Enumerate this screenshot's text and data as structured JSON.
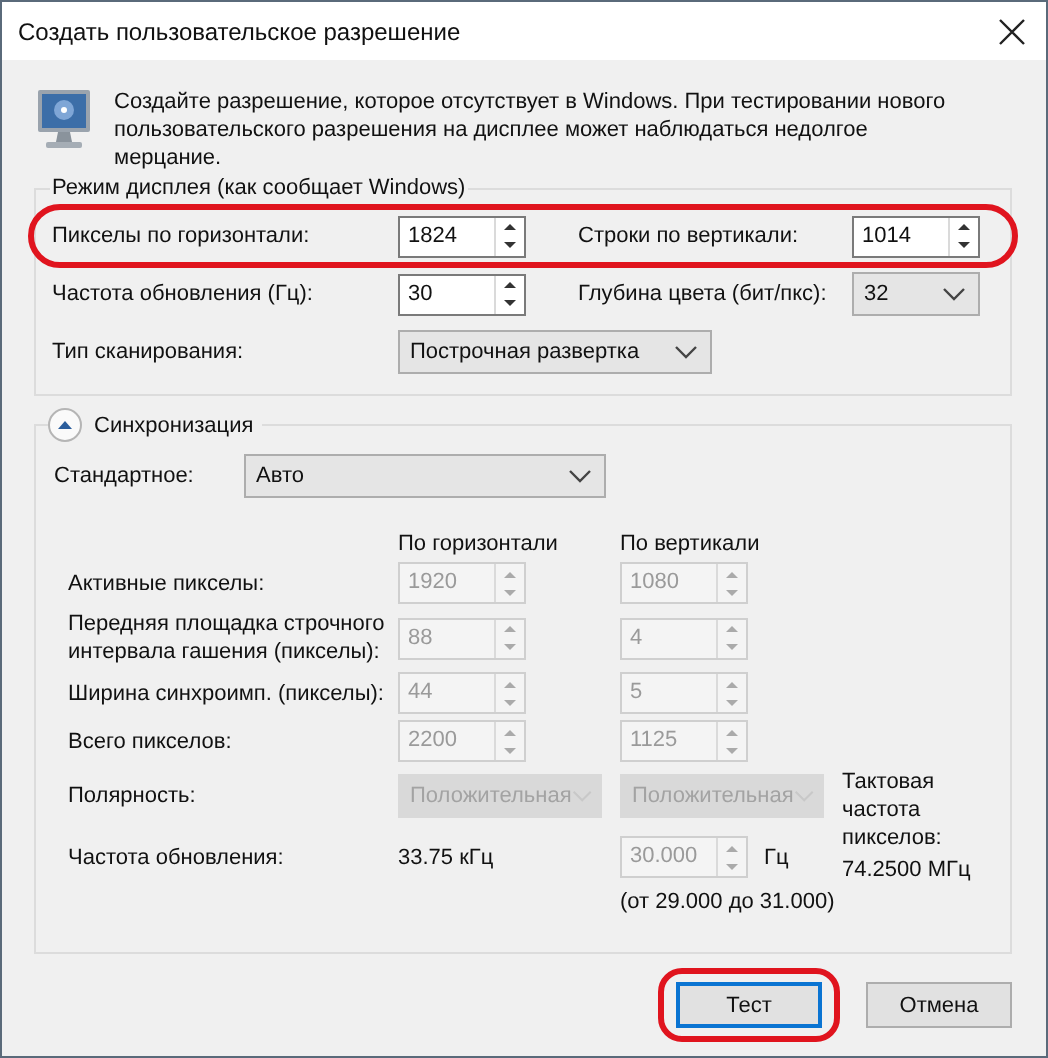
{
  "window": {
    "title": "Создать пользовательское разрешение"
  },
  "intro": {
    "text": "Создайте разрешение, которое отсутствует в Windows. При тестировании нового пользовательского разрешения на дисплее может наблюдаться недолгое мерцание."
  },
  "display_mode": {
    "title": "Режим дисплея (как сообщает Windows)",
    "rows": [
      {
        "highlighted": true,
        "fields": [
          {
            "kind": "spinner",
            "label": "Пикселы по горизонтали:",
            "value": "1824"
          },
          {
            "kind": "spinner",
            "label": "Строки по вертикали:",
            "value": "1014"
          }
        ]
      },
      {
        "highlighted": false,
        "fields": [
          {
            "kind": "spinner",
            "label": "Частота обновления (Гц):",
            "value": "30"
          },
          {
            "kind": "dropdown",
            "label": "Глубина цвета (бит/пкс):",
            "value": "32"
          }
        ]
      },
      {
        "highlighted": false,
        "fields": [
          {
            "kind": "dropdown",
            "label": "Тип сканирования:",
            "value": "Построчная развертка"
          }
        ]
      }
    ]
  },
  "timing": {
    "title": "Синхронизация",
    "expanded": true,
    "standard": {
      "label": "Стандартное:",
      "value": "Авто"
    },
    "column_headers": [
      "По горизонтали",
      "По вертикали"
    ],
    "rows": [
      {
        "kind": "spinners",
        "label": "Активные пикселы:",
        "horizontal": "1920",
        "vertical": "1080",
        "disabled": true
      },
      {
        "kind": "spinners",
        "label": "Передняя площадка строчного интервала гашения (пикселы):",
        "horizontal": "88",
        "vertical": "4",
        "disabled": true
      },
      {
        "kind": "spinners",
        "label": "Ширина синхроимп. (пикселы):",
        "horizontal": "44",
        "vertical": "5",
        "disabled": true
      },
      {
        "kind": "spinners",
        "label": "Всего пикселов:",
        "horizontal": "2200",
        "vertical": "1125",
        "disabled": true
      },
      {
        "kind": "dropdowns",
        "label": "Полярность:",
        "horizontal": "Положительная",
        "vertical": "Положительная",
        "disabled": true
      },
      {
        "kind": "refresh",
        "label": "Частота обновления:",
        "horizontal": "33.75 кГц",
        "vertical": "30.000",
        "unit": "Гц",
        "range": "(от 29.000 до 31.000)",
        "disabled": true
      }
    ],
    "pixel_clock": {
      "label": "Тактовая частота пикселов:",
      "value": "74.2500 МГц"
    }
  },
  "buttons": [
    {
      "label": "Тест",
      "default": true,
      "highlighted": true
    },
    {
      "label": "Отмена",
      "default": false,
      "highlighted": false
    }
  ]
}
